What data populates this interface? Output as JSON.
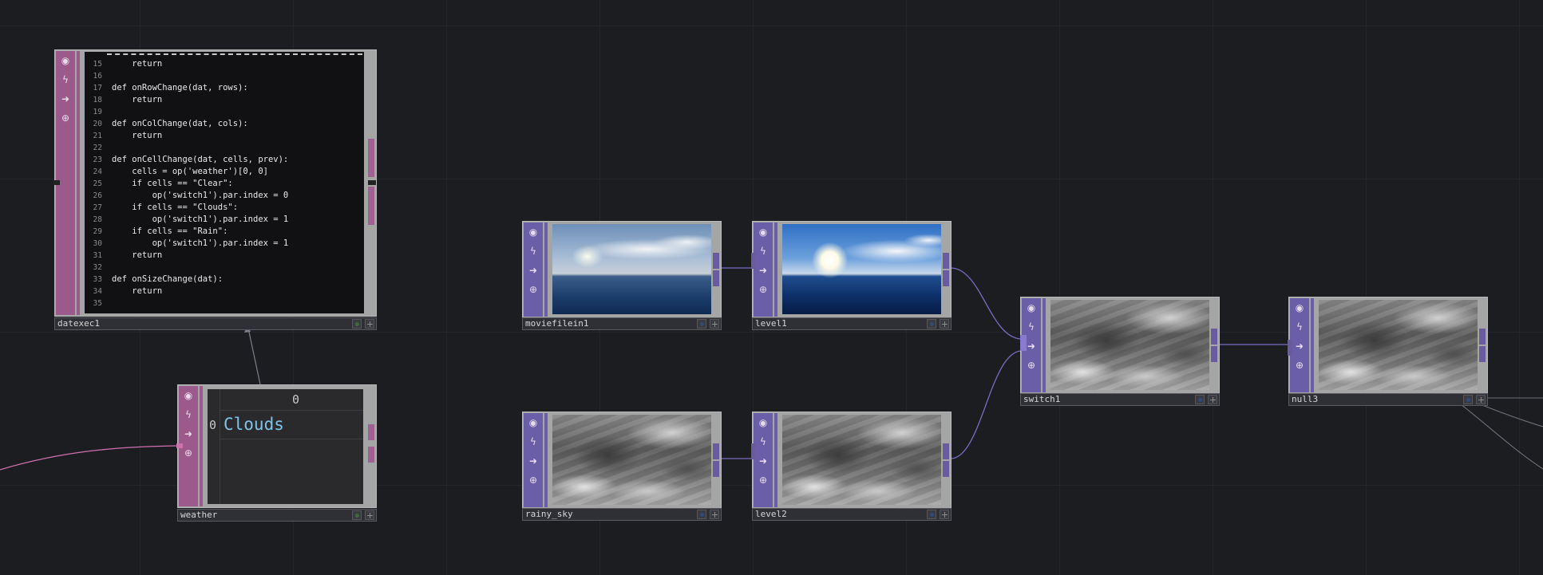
{
  "canvas": {
    "background": "#1c1d21"
  },
  "colors": {
    "dat": "#9c5a8c",
    "top": "#6b5ea8",
    "wire_dat": "#d070b0",
    "wire_top": "#7a6cc0"
  },
  "icons": [
    "viewer-toggle-icon",
    "cook-icon",
    "export-arrow-icon",
    "lock-icon"
  ],
  "nodes": {
    "datexec1": {
      "name": "datexec1",
      "code": [
        {
          "n": "15",
          "t": "    return"
        },
        {
          "n": "16",
          "t": ""
        },
        {
          "n": "17",
          "t": "def onRowChange(dat, rows):"
        },
        {
          "n": "18",
          "t": "    return"
        },
        {
          "n": "19",
          "t": ""
        },
        {
          "n": "20",
          "t": "def onColChange(dat, cols):"
        },
        {
          "n": "21",
          "t": "    return"
        },
        {
          "n": "22",
          "t": ""
        },
        {
          "n": "23",
          "t": "def onCellChange(dat, cells, prev):"
        },
        {
          "n": "24",
          "t": "    cells = op('weather')[0, 0]"
        },
        {
          "n": "25",
          "t": "    if cells == \"Clear\":"
        },
        {
          "n": "26",
          "t": "        op('switch1').par.index = 0"
        },
        {
          "n": "27",
          "t": "    if cells == \"Clouds\":"
        },
        {
          "n": "28",
          "t": "        op('switch1').par.index = 1"
        },
        {
          "n": "29",
          "t": "    if cells == \"Rain\":"
        },
        {
          "n": "30",
          "t": "        op('switch1').par.index = 1"
        },
        {
          "n": "31",
          "t": "    return"
        },
        {
          "n": "32",
          "t": ""
        },
        {
          "n": "33",
          "t": "def onSizeChange(dat):"
        },
        {
          "n": "34",
          "t": "    return"
        },
        {
          "n": "35",
          "t": ""
        }
      ]
    },
    "weather": {
      "name": "weather",
      "col_header": "0",
      "row_index": "0",
      "cell": "Clouds"
    },
    "moviefilein1": {
      "name": "moviefilein1"
    },
    "level1": {
      "name": "level1"
    },
    "rainy_sky": {
      "name": "rainy_sky"
    },
    "level2": {
      "name": "level2"
    },
    "switch1": {
      "name": "switch1"
    },
    "null3": {
      "name": "null3"
    }
  }
}
